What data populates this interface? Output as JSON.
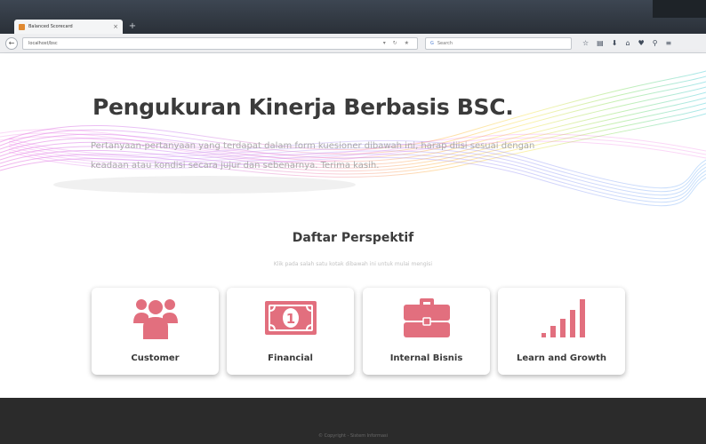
{
  "browser": {
    "tab_title": "Balanced Scorecard",
    "tab_close": "×",
    "new_tab": "+",
    "url": "localhost/bsc",
    "url_actions": "▾ ↻ ★",
    "search_engine": "G",
    "search_placeholder": "Search",
    "toolbar_icons": [
      "☆",
      "▤",
      "⬇",
      "⌂",
      "♥",
      "⚲",
      "≡"
    ]
  },
  "hero": {
    "title": "Pengukuran Kinerja Berbasis BSC.",
    "description": "Pertanyaan-pertanyaan yang terdapat dalam form kuesioner dibawah ini, harap diisi sesuai dengan keadaan atau kondisi secara jujur dan sebenarnya. Terima kasih."
  },
  "section": {
    "title": "Daftar Perspektif",
    "subtitle": "Klik pada salah satu kotak dibawah ini untuk mulai mengisi"
  },
  "perspectives": [
    {
      "label": "Customer",
      "icon": "users-icon"
    },
    {
      "label": "Financial",
      "icon": "money-bill-icon"
    },
    {
      "label": "Internal Bisnis",
      "icon": "briefcase-icon"
    },
    {
      "label": "Learn and Growth",
      "icon": "signal-bars-icon"
    }
  ],
  "footer": {
    "text": "© Copyright - Sistem Informasi"
  },
  "colors": {
    "icon_pink": "#e26f7e",
    "footer_bg": "#2b2b2b",
    "title_text": "#3b3b3b"
  }
}
